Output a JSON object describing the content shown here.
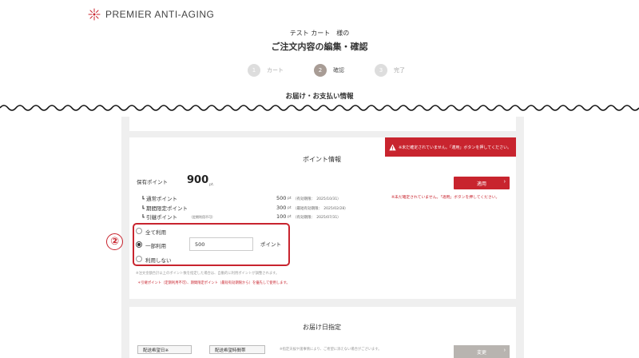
{
  "brand": {
    "name": "PREMIER ANTI-AGING"
  },
  "header": {
    "customer_name": "テスト カート　様の",
    "page_title": "ご注文内容の編集・確認"
  },
  "steps": [
    {
      "num": "1",
      "label": "カート"
    },
    {
      "num": "2",
      "label": "確認"
    },
    {
      "num": "3",
      "label": "完了"
    }
  ],
  "section_heading": "お届け・お支払い情報",
  "points": {
    "title": "ポイント情報",
    "alert": "※未だ確定されていません。「適用」ボタンを押してください。",
    "held_label": "保有ポイント",
    "held_value": "900",
    "held_unit": "pt.",
    "apply_label": "適用",
    "apply_note": "※未だ確定されていません。「適用」ボタンを押してください。",
    "rows": [
      {
        "label": "┗ 通常ポイント",
        "sub": "",
        "value": "500",
        "unit": "pt",
        "expiry": "（有効期限：　2025/10/31）"
      },
      {
        "label": "┗ 期間限定ポイント",
        "sub": "",
        "value": "300",
        "unit": "pt",
        "expiry": "（最短有効期限：　2025/02/28）"
      },
      {
        "label": "┗ 引継ポイント",
        "sub": "（定期利用不可）",
        "value": "100",
        "unit": "pt",
        "expiry": "（有効期限：　2025/07/31）"
      }
    ],
    "options": {
      "all": "全て利用",
      "partial": "一部利用",
      "none": "利用しない"
    },
    "partial_value": "500",
    "partial_unit": "ポイント",
    "annotation_number": "②",
    "note1": "※注文金額合計以上のポイント数を指定した場合は、自動的に利用ポイントが調整されます。",
    "note2": "＊引継ポイント（定期利用不可）、期間限定ポイント（最短有効期限から）を優先して使用します。"
  },
  "delivery": {
    "title": "お届け日指定",
    "date_label": "配送希望日※",
    "time_label": "配送希望時間帯",
    "note": "※指定天候や諸事情により、ご希望に添えない場合がございます。",
    "change_label": "変更"
  },
  "colors": {
    "accent": "#c8242e",
    "step_active": "#a89c95",
    "background": "#efefef"
  }
}
